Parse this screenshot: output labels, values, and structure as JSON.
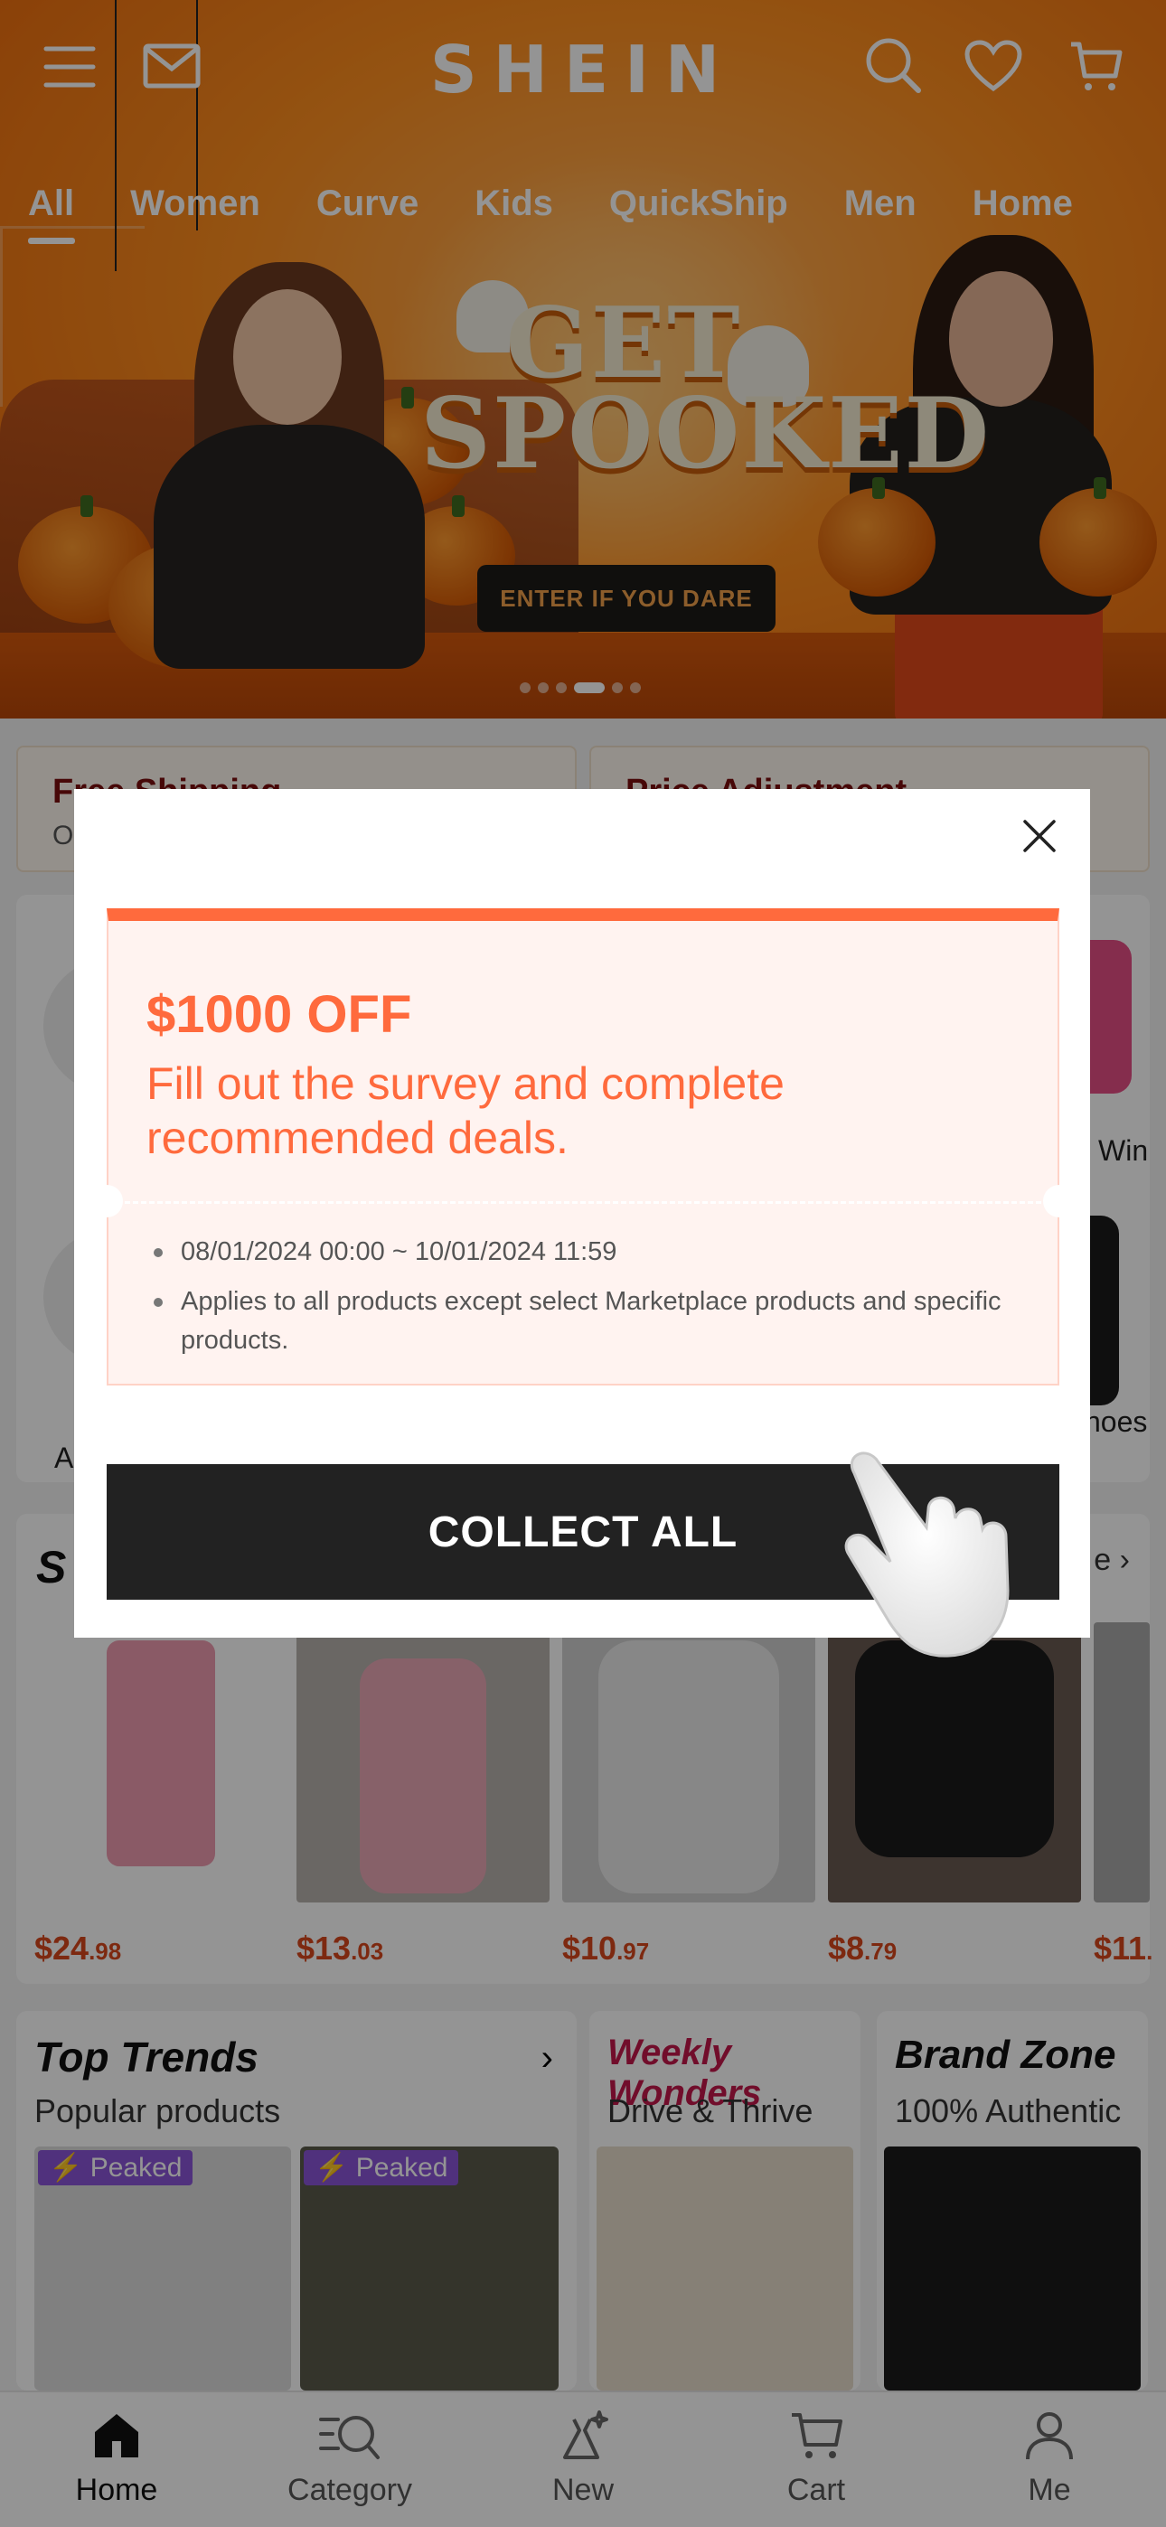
{
  "header": {
    "logo": "SHEIN",
    "tabs": [
      "All",
      "Women",
      "Curve",
      "Kids",
      "QuickShip",
      "Men",
      "Home"
    ],
    "active_tab": "All",
    "icons": [
      "menu-icon",
      "mail-icon",
      "search-icon",
      "heart-icon",
      "cart-icon"
    ]
  },
  "hero": {
    "headline": "GET SPOOKED",
    "cta": "ENTER IF YOU DARE"
  },
  "info_cards": [
    {
      "title": "Free Shipping",
      "sub": "O"
    },
    {
      "title": "Price Adjustment",
      "sub": ""
    }
  ],
  "categories": {
    "visible_labels": [
      "Win",
      "A",
      "hoes"
    ]
  },
  "super_deals": {
    "title_visible": "S",
    "more": "e",
    "prices": [
      {
        "main": "$24",
        "cents": ".98"
      },
      {
        "main": "$13",
        "cents": ".03"
      },
      {
        "main": "$10",
        "cents": ".97"
      },
      {
        "main": "$8",
        "cents": ".79"
      },
      {
        "main": "$11",
        "cents": "."
      }
    ]
  },
  "promo_cards": [
    {
      "title": "Top Trends",
      "sub": "Popular products",
      "tags": [
        "Peaked",
        "Peaked"
      ]
    },
    {
      "title": "Weekly Wonders",
      "sub": "Drive & Thrive"
    },
    {
      "title": "Brand Zone",
      "sub": "100% Authentic"
    }
  ],
  "modal": {
    "coupon_amount": "$1000 OFF",
    "coupon_desc": "Fill out the survey and complete recommended deals.",
    "rules": [
      "08/01/2024 00:00 ~ 10/01/2024 11:59",
      "Applies to all products except select Marketplace products and specific products."
    ],
    "button": "COLLECT ALL",
    "accent_color": "#ff6a3d"
  },
  "nav": {
    "items": [
      {
        "label": "Home",
        "icon": "home-icon",
        "active": true
      },
      {
        "label": "Category",
        "icon": "category-search-icon",
        "active": false
      },
      {
        "label": "New",
        "icon": "sparkle-dress-icon",
        "active": false
      },
      {
        "label": "Cart",
        "icon": "cart-icon",
        "active": false
      },
      {
        "label": "Me",
        "icon": "person-icon",
        "active": false
      }
    ]
  }
}
